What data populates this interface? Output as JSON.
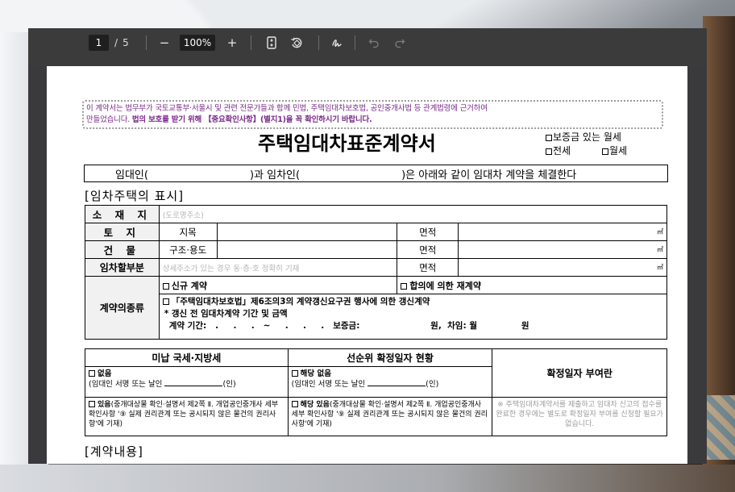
{
  "toolbar": {
    "current_page": "1",
    "page_separator": "/",
    "total_pages": "5",
    "zoom_out": "−",
    "zoom_level": "100%",
    "zoom_in": "+"
  },
  "document": {
    "notice_line1": "이 계약서는 법무부가 국토교통부·서울시 및 관련 전문가들과 함께 민법, 주택임대차보호법, 공인중개사법 등 관계법령에 근거하여",
    "notice_line2_plain": "만들었습니다. ",
    "notice_line2_bold": "법의 보호를 받기 위해 【중요확인사항】(별지1)을 꼭 확인하시기 바랍니다.",
    "title": "주택임대차표준계약서",
    "option_monthly_deposit": "보증금 있는 월세",
    "option_jeonse": "전세",
    "option_monthly": "월세",
    "party_line_a": "임대인(",
    "party_line_b": ")과 임차인(",
    "party_line_c": ")은 아래와 같이 임대차 계약을 체결한다",
    "section1": "[임차주택의 표시]",
    "section2": "[계약내용]",
    "rows": {
      "location_label": "소 재 지",
      "location_placeholder": "(도로명주소)",
      "land_label": "토  지",
      "land_sub": "지목",
      "area_label": "면적",
      "unit_m2": "㎡",
      "building_label": "건  물",
      "building_sub": "구조·용도",
      "part_label": "임차할부분",
      "part_placeholder": "상세주소가 있는 경우 동·층·호 정확히 기재",
      "contract_type_label": "계약의종류",
      "new_contract": "신규 계약",
      "agreed_renewal": "합의에 의한 재계약",
      "renewal_right": "「주택임대차보호법」제6조의3의 계약갱신요구권 행사에 의한 갱신계약",
      "prev_terms": "* 갱신 전 임대차계약 기간 및 금액",
      "period_label": "계약 기간:",
      "period_dots": ".     .     .   ~     .     .     .",
      "deposit_label": "보증금:",
      "won1": "원,",
      "rent_label": "차임:",
      "monthly_label": "월",
      "won2": "원"
    },
    "tax": {
      "header_unpaid": "미납 국세·지방세",
      "header_priority": "선순위 확정일자 현황",
      "none": "없음",
      "sign_line": "(임대인 서명 또는 날인",
      "seal": "인",
      "exists": "있음",
      "exists_note": "(중개대상물 확인·설명서 제2쪽 Ⅱ. 개업공인중개사 세부 확인사항 '⑨ 실제 권리관계 또는 공시되지 않은 물건의 권리사항'에 기재)",
      "applicable_none": "해당 없음",
      "applicable_exists": "해당 있음",
      "confirm_header": "확정일자 부여란",
      "confirm_note": "※ 주택임대차계약서를 제출하고 임대차 신고의 접수를 완료한 경우에는 별도로 확정일자 부여를 신청할 필요가 없습니다."
    }
  }
}
